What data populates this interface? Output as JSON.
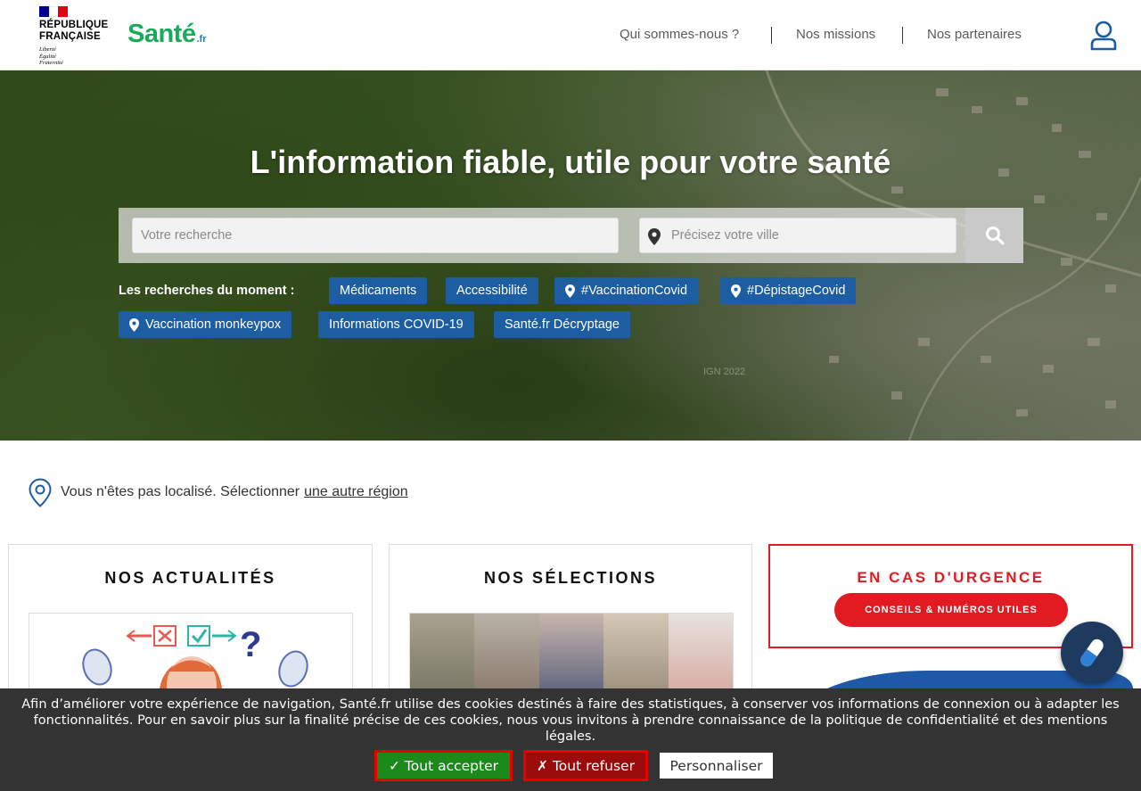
{
  "header": {
    "rf_title": "RÉPUBLIQUE\nFRANÇAISE",
    "rf_motto": "Liberté\nÉgalité\nFraternité",
    "brand_word": "Santé",
    "brand_ext": ".fr",
    "nav": [
      "Qui sommes-nous ?",
      "Nos missions",
      "Nos partenaires"
    ],
    "user_icon": "user-account-icon"
  },
  "hero": {
    "title": "L'information fiable, utile pour votre santé",
    "search_placeholder": "Votre recherche",
    "city_placeholder": "Précisez votre ville",
    "search_icon": "search-icon",
    "trending_label": "Les recherches du moment :",
    "chips": [
      "Médicaments",
      "Accessibilité",
      "#VaccinationCovid",
      "#DépistageCovid",
      "Vaccination monkeypox",
      "Informations COVID-19",
      "Santé.fr Décryptage"
    ],
    "credit": "IGN 2022"
  },
  "location": {
    "text": "Vous n'êtes pas localisé.  Sélectionner",
    "link": "une autre région"
  },
  "cards": {
    "news_title": "NOS ACTUALITÉS",
    "selections_title": "NOS SÉLECTIONS"
  },
  "urgent": {
    "title": "EN CAS D'URGENCE",
    "button": "CONSEILS & NUMÉROS UTILES"
  },
  "cookie": {
    "text": "Afin d’améliorer votre expérience de navigation, Santé.fr utilise des cookies destinés à faire des statistiques, à conserver vos informations de connexion ou à adapter les fonctionnalités. Pour en savoir plus sur la finalité précise de ces cookies, nous vous invitons à prendre connaissance de la politique de confidentialité et des mentions légales.",
    "accept": "✓ Tout accepter",
    "refuse": "✗ Tout refuser",
    "customize": "Personnaliser"
  },
  "colors": {
    "brand_green": "#1aaa5a",
    "chip_blue": "#1c5ea1",
    "urgent_red": "#e21b23",
    "cookie_bg": "#333333"
  }
}
